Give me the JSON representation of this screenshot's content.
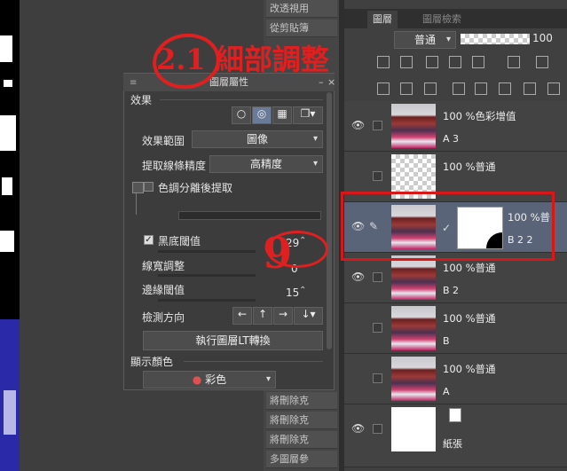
{
  "top_menu": {
    "item1": "改透視用",
    "item2": "從剪貼簿"
  },
  "layer_panel": {
    "tabs": [
      "圖層",
      "圖層檢索"
    ],
    "blend_mode": "普通",
    "opacity": "100",
    "layers": [
      {
        "name": "100 %色彩增值",
        "sub": "A 3"
      },
      {
        "name": "100 %普通",
        "sub": ""
      },
      {
        "name": "100 %普",
        "sub": "B 2 2"
      },
      {
        "name": "100 %普通",
        "sub": "B 2"
      },
      {
        "name": "100 %普通",
        "sub": "B"
      },
      {
        "name": "100 %普通",
        "sub": "A"
      },
      {
        "name": "",
        "sub": "紙張"
      }
    ]
  },
  "tool_items": [
    "將刪除克",
    "將刪除克",
    "將刪除克",
    "多圖層參"
  ],
  "dialog": {
    "title": "圖層屬性",
    "section_effect": "效果",
    "effect_range_label": "效果範圍",
    "effect_range_value": "圖像",
    "line_precision_label": "提取線條精度",
    "line_precision_value": "高精度",
    "color_separate_label": "色調分離後提取",
    "black_threshold_label": "黑底閾值",
    "black_threshold_value": "29",
    "line_width_label": "線寬調整",
    "line_width_value": "0",
    "edge_threshold_label": "邊緣閾值",
    "edge_threshold_value": "15",
    "detect_dir_label": "檢測方向",
    "execute_label": "執行圖層LT轉換",
    "display_color_label": "顯示顏色",
    "display_color_value": "彩色"
  },
  "annotation": {
    "title": "2.1 細部調整",
    "mark": "9"
  }
}
